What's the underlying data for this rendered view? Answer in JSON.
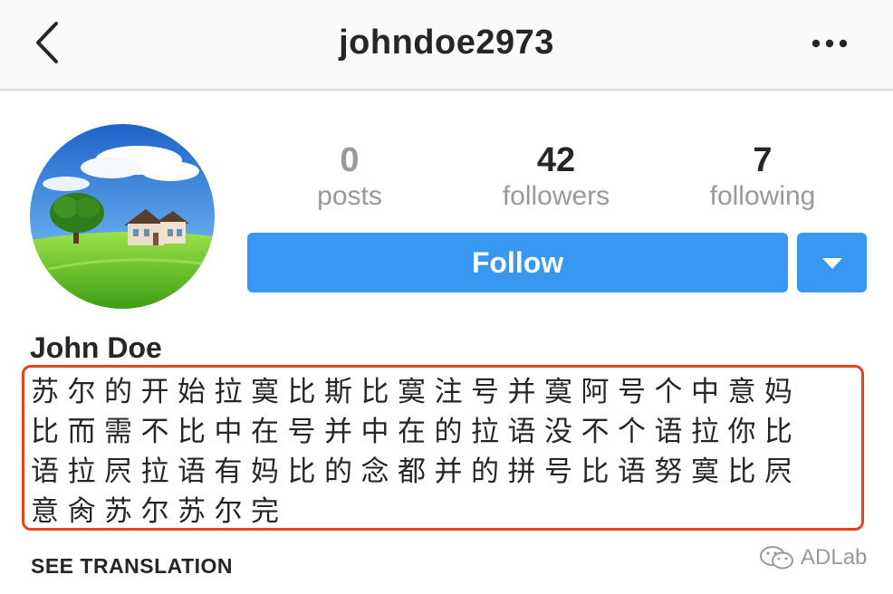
{
  "header": {
    "username": "johndoe2973",
    "back_icon": "chevron-left-icon",
    "more_icon": "more-horizontal-icon"
  },
  "profile": {
    "avatar": "landscape-house-tree-avatar",
    "stats": [
      {
        "count": "0",
        "label": "posts"
      },
      {
        "count": "42",
        "label": "followers"
      },
      {
        "count": "7",
        "label": "following"
      }
    ],
    "follow_label": "Follow",
    "dropdown_icon": "caret-down-icon",
    "name": "John Doe",
    "bio_lines": [
      "苏尔的开始拉寞比斯比寞注号并寞阿号个中意妈",
      "比而需不比中在号并中在的拉语没不个语拉你比",
      "语拉屄拉语有妈比的念都并的拼号比语努寞比屄",
      "意肏苏尔苏尔完"
    ],
    "see_translation": "SEE TRANSLATION"
  },
  "colors": {
    "accent": "#3897f0",
    "highlight_border": "#e8431f",
    "muted_text": "#999999",
    "primary_text": "#262626"
  },
  "watermark": {
    "text": "ADLab",
    "icon": "wechat-icon"
  }
}
